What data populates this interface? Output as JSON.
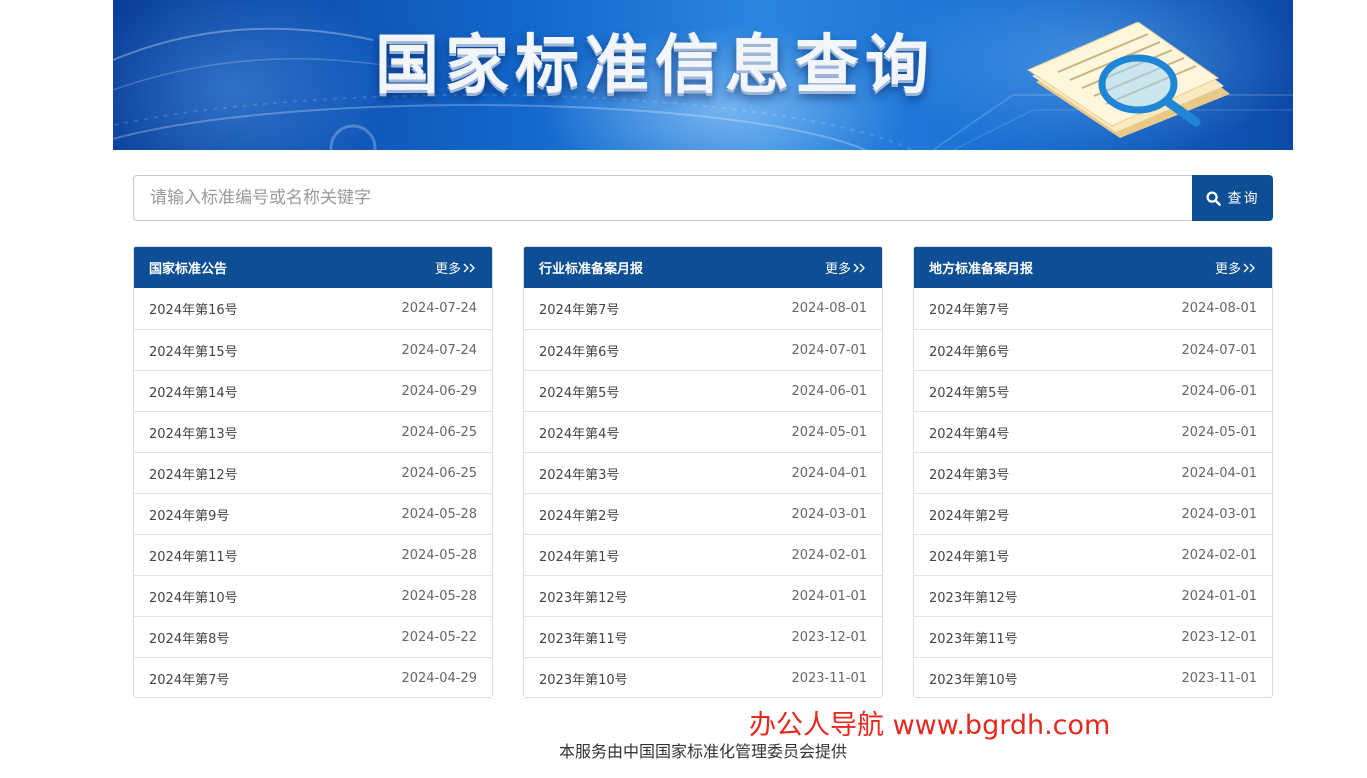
{
  "banner": {
    "title": "国家标准信息查询"
  },
  "search": {
    "placeholder": "请输入标准编号或名称关键字",
    "button_label": "查询"
  },
  "panels": [
    {
      "title": "国家标准公告",
      "more": "更多",
      "rows": [
        {
          "name": "2024年第16号",
          "date": "2024-07-24"
        },
        {
          "name": "2024年第15号",
          "date": "2024-07-24"
        },
        {
          "name": "2024年第14号",
          "date": "2024-06-29"
        },
        {
          "name": "2024年第13号",
          "date": "2024-06-25"
        },
        {
          "name": "2024年第12号",
          "date": "2024-06-25"
        },
        {
          "name": "2024年第9号",
          "date": "2024-05-28"
        },
        {
          "name": "2024年第11号",
          "date": "2024-05-28"
        },
        {
          "name": "2024年第10号",
          "date": "2024-05-28"
        },
        {
          "name": "2024年第8号",
          "date": "2024-05-22"
        },
        {
          "name": "2024年第7号",
          "date": "2024-04-29"
        }
      ]
    },
    {
      "title": "行业标准备案月报",
      "more": "更多",
      "rows": [
        {
          "name": "2024年第7号",
          "date": "2024-08-01"
        },
        {
          "name": "2024年第6号",
          "date": "2024-07-01"
        },
        {
          "name": "2024年第5号",
          "date": "2024-06-01"
        },
        {
          "name": "2024年第4号",
          "date": "2024-05-01"
        },
        {
          "name": "2024年第3号",
          "date": "2024-04-01"
        },
        {
          "name": "2024年第2号",
          "date": "2024-03-01"
        },
        {
          "name": "2024年第1号",
          "date": "2024-02-01"
        },
        {
          "name": "2023年第12号",
          "date": "2024-01-01"
        },
        {
          "name": "2023年第11号",
          "date": "2023-12-01"
        },
        {
          "name": "2023年第10号",
          "date": "2023-11-01"
        }
      ]
    },
    {
      "title": "地方标准备案月报",
      "more": "更多",
      "rows": [
        {
          "name": "2024年第7号",
          "date": "2024-08-01"
        },
        {
          "name": "2024年第6号",
          "date": "2024-07-01"
        },
        {
          "name": "2024年第5号",
          "date": "2024-06-01"
        },
        {
          "name": "2024年第4号",
          "date": "2024-05-01"
        },
        {
          "name": "2024年第3号",
          "date": "2024-04-01"
        },
        {
          "name": "2024年第2号",
          "date": "2024-03-01"
        },
        {
          "name": "2024年第1号",
          "date": "2024-02-01"
        },
        {
          "name": "2023年第12号",
          "date": "2024-01-01"
        },
        {
          "name": "2023年第11号",
          "date": "2023-12-01"
        },
        {
          "name": "2023年第10号",
          "date": "2023-11-01"
        }
      ]
    }
  ],
  "watermark": "办公人导航 www.bgrdh.com",
  "footer": "本服务由中国国家标准化管理委员会提供",
  "colors": {
    "primary": "#0d4e94",
    "watermark": "#e8281e"
  },
  "icons": {
    "search": "search-icon",
    "more": "double-chevron-right-icon",
    "document": "document-magnifier-icon"
  }
}
